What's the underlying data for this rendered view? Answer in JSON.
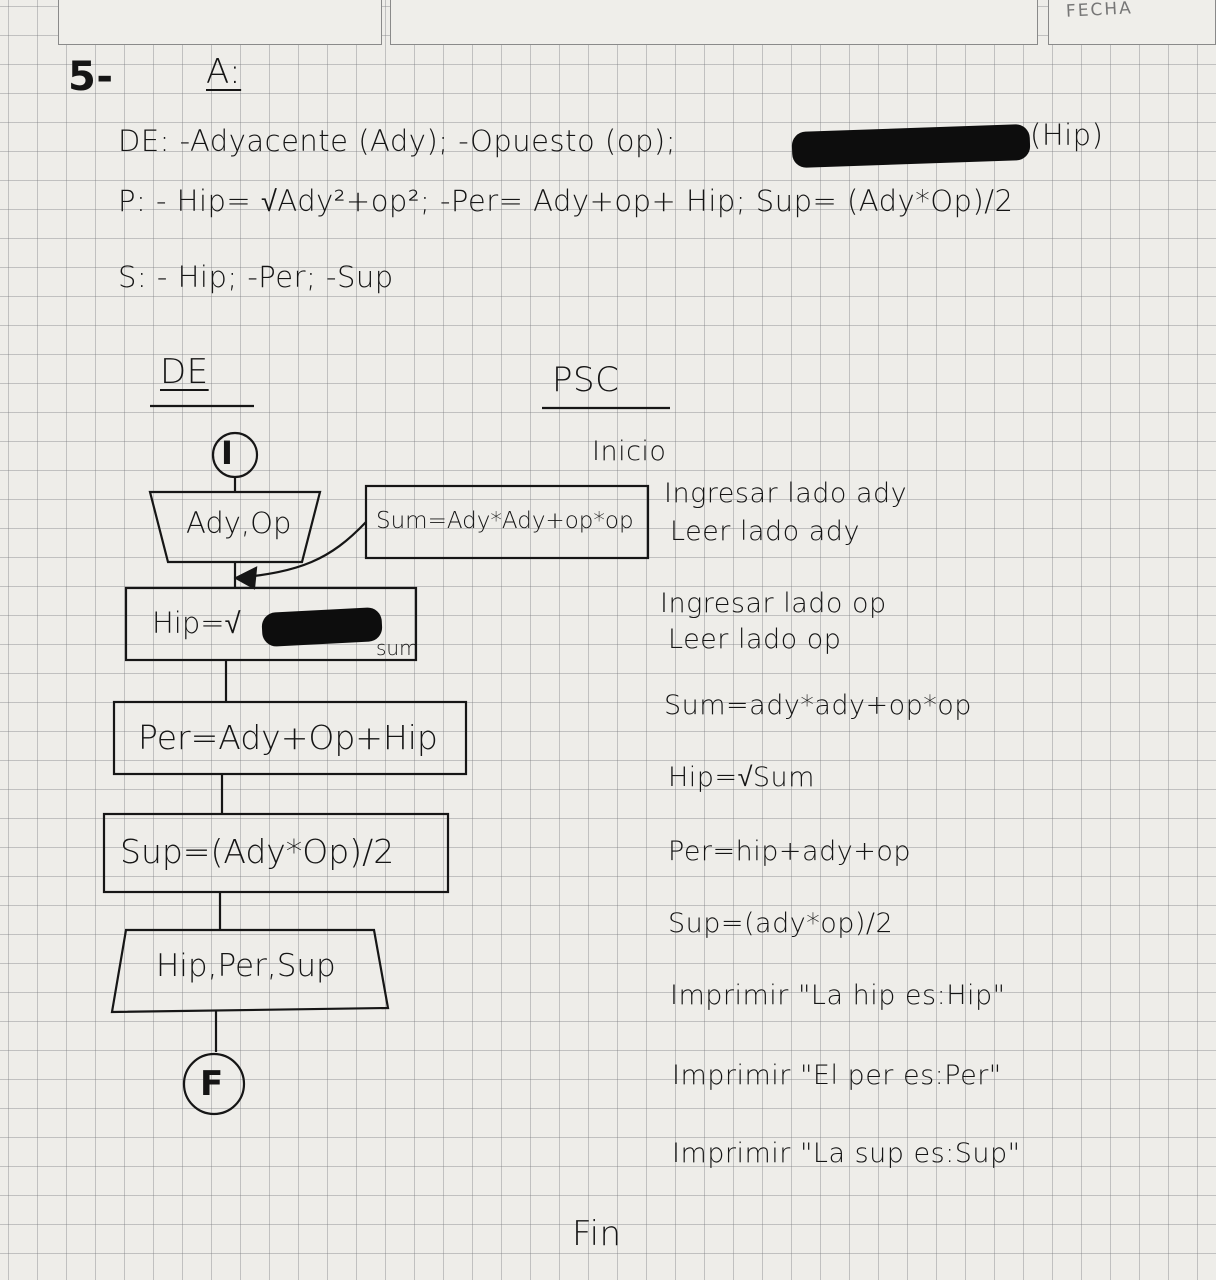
{
  "header": {
    "fecha_label": "FECHA"
  },
  "exercise": {
    "number": "5-",
    "title": "A:",
    "de_line": "DE: -Adyacente (Ady); -Opuesto (op);",
    "de_line_tail": "(Hip)",
    "p_line": "P: - Hip= √Ady²+op²; -Per= Ady+op+ Hip; Sup= (Ady*Op)/2",
    "s_line": "S: - Hip; -Per; -Sup"
  },
  "diagram": {
    "heading": "DE",
    "start": "I",
    "input": "Ady,Op",
    "side_process": "Sum=Ady*Ady+op*op",
    "hip": "Hip=√",
    "hip_tail": "sum",
    "per": "Per=Ady+Op+Hip",
    "sup": "Sup=(Ady*Op)/2",
    "output": "Hip,Per,Sup",
    "end": "F"
  },
  "pseudocode": {
    "heading": "PSC",
    "start": "Inicio",
    "lines": [
      "Ingresar lado ady",
      "Leer lado ady",
      "Ingresar lado op",
      "Leer lado op",
      "Sum=ady*ady+op*op",
      "Hip=√Sum",
      "Per=hip+ady+op",
      "Sup=(ady*op)/2",
      "Imprimir \"La hip es:Hip\"",
      "Imprimir \"El per es:Per\"",
      "Imprimir \"La sup es:Sup\""
    ],
    "end": "Fin"
  }
}
